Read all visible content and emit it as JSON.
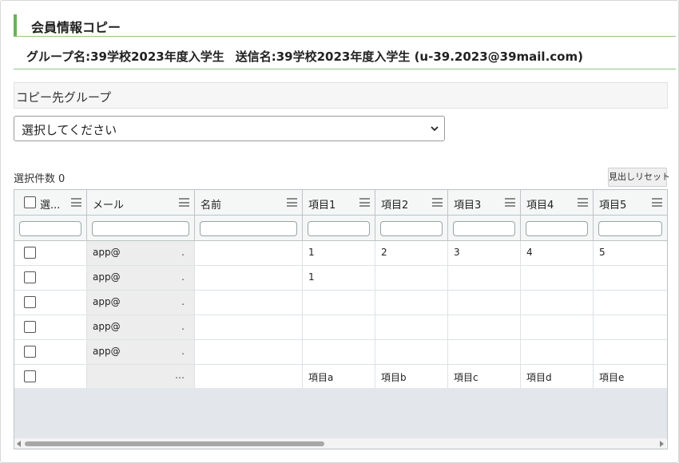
{
  "title": "会員情報コピー",
  "info": {
    "group": "グループ名:39学校2023年度入学生",
    "sender": "送信名:39学校2023年度入学生 (u-39.2023@39mail.com)"
  },
  "copy_target": {
    "section_label": "コピー先グループ",
    "select_value": "選択してください"
  },
  "selection": {
    "label": "選択件数",
    "count": "0"
  },
  "reset_button": "見出しリセット",
  "grid": {
    "columns": [
      "選...",
      "メール",
      "名前",
      "項目1",
      "項目2",
      "項目3",
      "項目4",
      "項目5"
    ],
    "rows": [
      {
        "mail": "app@",
        "mail_end": ".",
        "cells": [
          "1",
          "2",
          "3",
          "4",
          "5"
        ]
      },
      {
        "mail": "app@",
        "mail_end": ".",
        "cells": [
          "1",
          "",
          "",
          "",
          ""
        ]
      },
      {
        "mail": "app@",
        "mail_end": ".",
        "cells": [
          "",
          "",
          "",
          "",
          ""
        ]
      },
      {
        "mail": "app@",
        "mail_end": ".",
        "cells": [
          "",
          "",
          "",
          "",
          ""
        ]
      },
      {
        "mail": "app@",
        "mail_end": ".",
        "cells": [
          "",
          "",
          "",
          "",
          ""
        ]
      },
      {
        "mail": "",
        "mail_end": "…",
        "cells": [
          "項目a",
          "項目b",
          "項目c",
          "項目d",
          "項目e"
        ]
      }
    ]
  },
  "icons": {
    "select_chevron": "chevron-down-icon",
    "column_menu": "hamburger-menu-icon",
    "scroll_left": "arrow-left-icon",
    "scroll_right": "arrow-right-icon"
  },
  "colors": {
    "accent_green": "#68b25a",
    "grid_border": "#bdc3c7",
    "header_bg": "#f5f7f7",
    "empty_area": "#e3e7ec"
  }
}
